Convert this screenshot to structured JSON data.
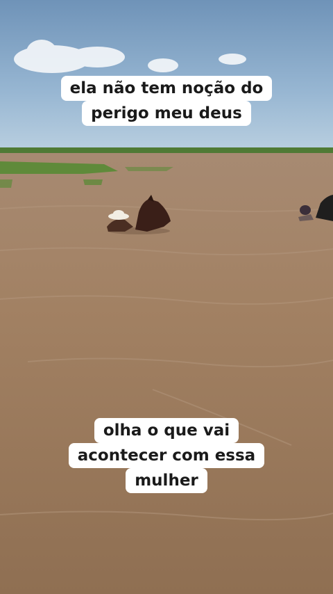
{
  "captions": {
    "top": [
      "ela não tem noção do",
      "perigo meu deus"
    ],
    "bottom": [
      "olha o que vai",
      "acontecer com essa",
      "mulher"
    ]
  },
  "scene": {
    "sky_color": "#7ea6c8",
    "water_color": "#9b7b5f",
    "grass_color": "#5f8a3a"
  }
}
